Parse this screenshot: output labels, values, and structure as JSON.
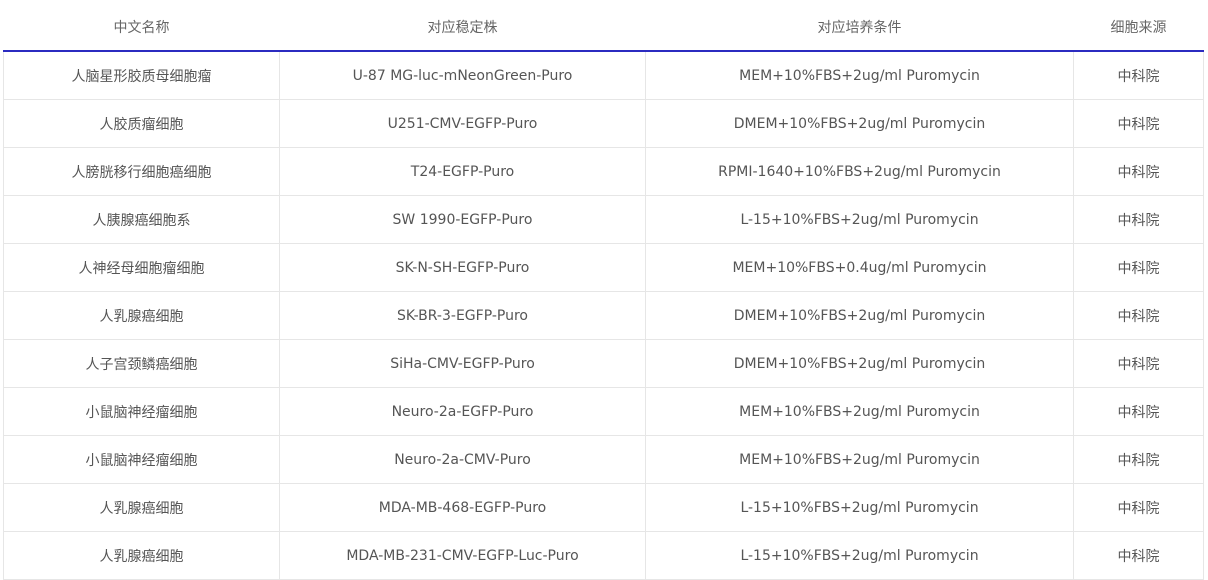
{
  "table": {
    "headers": [
      "中文名称",
      "对应稳定株",
      "对应培养条件",
      "细胞来源"
    ],
    "rows": [
      [
        "人脑星形胶质母细胞瘤",
        "U-87 MG-luc-mNeonGreen-Puro",
        "MEM+10%FBS+2ug/ml Puromycin",
        "中科院"
      ],
      [
        "人胶质瘤细胞",
        "U251-CMV-EGFP-Puro",
        "DMEM+10%FBS+2ug/ml Puromycin",
        "中科院"
      ],
      [
        "人膀胱移行细胞癌细胞",
        "T24-EGFP-Puro",
        "RPMI-1640+10%FBS+2ug/ml Puromycin",
        "中科院"
      ],
      [
        "人胰腺癌细胞系",
        "SW 1990-EGFP-Puro",
        "L-15+10%FBS+2ug/ml Puromycin",
        "中科院"
      ],
      [
        "人神经母细胞瘤细胞",
        "SK-N-SH-EGFP-Puro",
        "MEM+10%FBS+0.4ug/ml Puromycin",
        "中科院"
      ],
      [
        "人乳腺癌细胞",
        "SK-BR-3-EGFP-Puro",
        "DMEM+10%FBS+2ug/ml Puromycin",
        "中科院"
      ],
      [
        "人子宫颈鳞癌细胞",
        "SiHa-CMV-EGFP-Puro",
        "DMEM+10%FBS+2ug/ml Puromycin",
        "中科院"
      ],
      [
        "小鼠脑神经瘤细胞",
        "Neuro-2a-EGFP-Puro",
        "MEM+10%FBS+2ug/ml Puromycin",
        "中科院"
      ],
      [
        "小鼠脑神经瘤细胞",
        "Neuro-2a-CMV-Puro",
        "MEM+10%FBS+2ug/ml Puromycin",
        "中科院"
      ],
      [
        "人乳腺癌细胞",
        "MDA-MB-468-EGFP-Puro",
        "L-15+10%FBS+2ug/ml Puromycin",
        "中科院"
      ],
      [
        "人乳腺癌细胞",
        "MDA-MB-231-CMV-EGFP-Luc-Puro",
        "L-15+10%FBS+2ug/ml Puromycin",
        "中科院"
      ]
    ]
  },
  "colors": {
    "header_rule": "#2b2bc0",
    "cell_border": "#e6e6e6",
    "text": "#555555"
  }
}
